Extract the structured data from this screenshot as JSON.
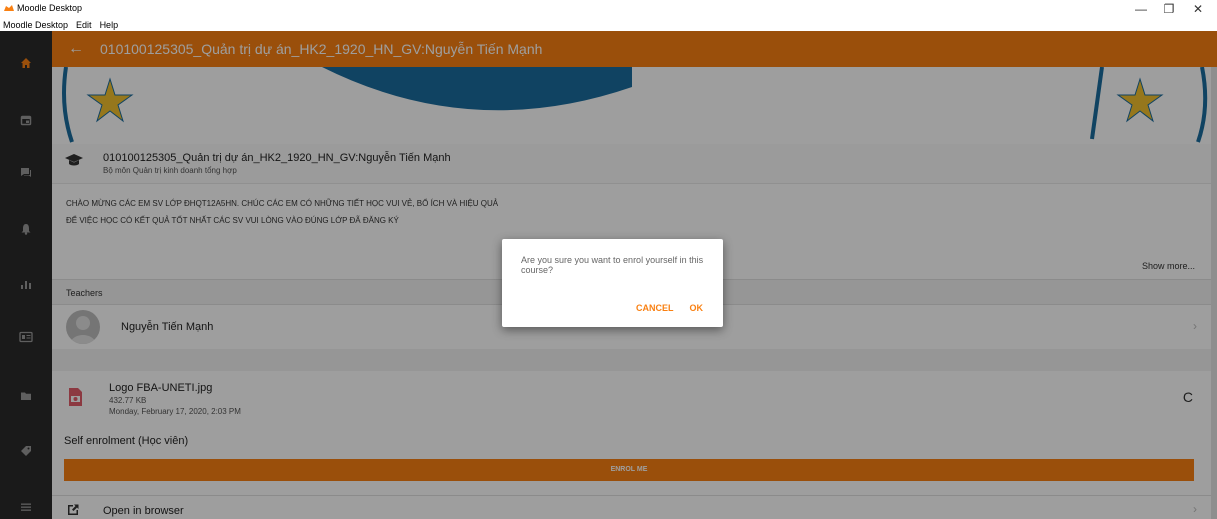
{
  "window": {
    "title": "Moodle Desktop",
    "minimize_glyph": "—",
    "maximize_glyph": "❐",
    "close_glyph": "✕"
  },
  "menu": [
    "Moodle Desktop",
    "Edit",
    "Help"
  ],
  "rail": {
    "items": [
      "home-icon",
      "calendar-icon",
      "messages-icon",
      "notifications-icon",
      "grades-icon",
      "badge-icon",
      "files-icon",
      "tag-icon",
      "more-menu-icon"
    ]
  },
  "header": {
    "back_glyph": "←",
    "title": "010100125305_Quản trị dự án_HK2_1920_HN_GV:Nguyễn Tiến Mạnh"
  },
  "course": {
    "fullname": "010100125305_Quản trị dự án_HK2_1920_HN_GV:Nguyễn Tiến Mạnh",
    "category": "Bộ môn Quản trị kinh doanh tổng hợp"
  },
  "summary": {
    "line1": "CHÀO MỪNG CÁC EM SV LỚP ĐHQT12A5HN. CHÚC CÁC EM CÓ NHỮNG TIẾT HỌC VUI VẺ, BỔ ÍCH VÀ HIỆU QUẢ",
    "line2": "ĐỂ VIỆC HỌC CÓ KẾT QUẢ TỐT NHẤT CÁC SV VUI LÒNG VÀO ĐÚNG LỚP ĐÃ ĐĂNG KÝ",
    "show_more": "Show more..."
  },
  "teachers": {
    "header": "Teachers",
    "items": [
      {
        "name": "Nguyễn Tiến Mạnh"
      }
    ]
  },
  "file": {
    "name": "Logo FBA-UNETI.jpg",
    "size": "432.77 KB",
    "date": "Monday, February 17, 2020, 2:03 PM",
    "refresh_glyph": "C"
  },
  "enrol": {
    "label": "Self enrolment (Học viên)",
    "button": "ENROL ME"
  },
  "open_browser": {
    "label": "Open in browser"
  },
  "dialog": {
    "message": "Are you sure you want to enrol yourself in this course?",
    "cancel": "CANCEL",
    "ok": "OK"
  },
  "colors": {
    "accent": "#f98012",
    "rail": "#2b2b2b",
    "banner_blue": "#1b6d9e",
    "star_yellow": "#f2c12e"
  },
  "chevron_glyph": "›"
}
